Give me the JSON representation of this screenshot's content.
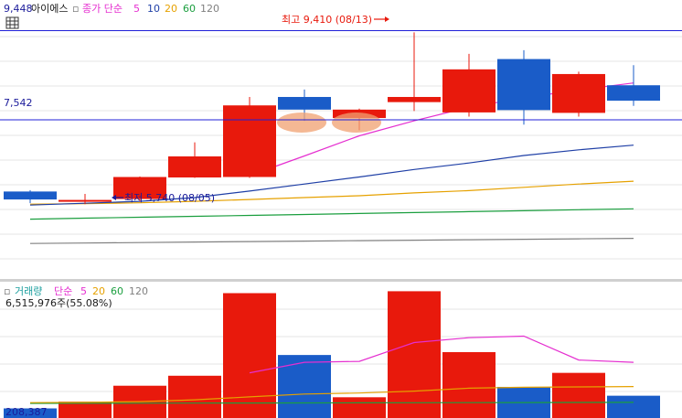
{
  "header": {
    "stock_name": "아이에스",
    "price_legend": {
      "label": "종가 단순",
      "periods": [
        "5",
        "10",
        "20",
        "60",
        "120"
      ]
    },
    "volume_legend": {
      "label": "거래량",
      "ma_label": "단순",
      "periods": [
        "5",
        "20",
        "60",
        "120"
      ]
    },
    "volume_info": "6,515,976주(55.08%)"
  },
  "price_axis": {
    "top_label": "9,448",
    "ref_label": "7,542",
    "top_value": 9448,
    "ref_value": 7542
  },
  "volume_axis": {
    "bottom_label": "208,387"
  },
  "annotations": {
    "high": "최고 9,410 (08/13)",
    "low": "최저 5,740 (08/05)"
  },
  "colors": {
    "up": "#e8190c",
    "down": "#1a5cc8",
    "ma5": "#e52fd0",
    "ma10": "#1f3fa6",
    "ma20": "#e6a100",
    "ma60": "#1a9e3e",
    "ma120": "#808080",
    "ref_line": "#2020d8",
    "highlight": "#f0a070"
  },
  "chart_data": {
    "type": "candlestick",
    "y_range": [
      4200,
      9750
    ],
    "candles": [
      {
        "open": 6010,
        "close": 5840,
        "high": 6040,
        "low": 5760
      },
      {
        "open": 5810,
        "close": 5830,
        "high": 5960,
        "low": 5740
      },
      {
        "open": 5850,
        "close": 6320,
        "high": 6330,
        "low": 5800
      },
      {
        "open": 6310,
        "close": 6760,
        "high": 7060,
        "low": 6300
      },
      {
        "open": 6320,
        "close": 7850,
        "high": 8030,
        "low": 6300
      },
      {
        "open": 8030,
        "close": 7760,
        "high": 8190,
        "low": 7520
      },
      {
        "open": 7580,
        "close": 7760,
        "high": 7780,
        "low": 7320
      },
      {
        "open": 7920,
        "close": 8030,
        "high": 9410,
        "low": 7730
      },
      {
        "open": 7700,
        "close": 8620,
        "high": 8950,
        "low": 7610
      },
      {
        "open": 8840,
        "close": 7750,
        "high": 9030,
        "low": 7440
      },
      {
        "open": 7690,
        "close": 8520,
        "high": 8570,
        "low": 7610
      },
      {
        "open": 8280,
        "close": 7950,
        "high": 8710,
        "low": 7840
      }
    ],
    "ma5": [
      null,
      null,
      null,
      null,
      6350,
      6770,
      7200,
      7520,
      7810,
      8010,
      8180,
      8330
    ],
    "ma10": [
      5720,
      5760,
      5800,
      5880,
      6020,
      6170,
      6320,
      6480,
      6620,
      6780,
      6900,
      7000
    ],
    "ma20": [
      5740,
      5750,
      5770,
      5800,
      5840,
      5880,
      5920,
      5980,
      6030,
      6100,
      6170,
      6230
    ],
    "ma60": [
      5420,
      5440,
      5460,
      5480,
      5500,
      5520,
      5540,
      5560,
      5580,
      5600,
      5620,
      5640
    ],
    "ma120": [
      4900,
      4910,
      4920,
      4930,
      4940,
      4950,
      4960,
      4970,
      4980,
      4990,
      5000,
      5010
    ],
    "volume": {
      "y_max": 7000000,
      "values": [
        500000,
        850000,
        1680000,
        2200000,
        6500000,
        3280000,
        1080000,
        6600000,
        3430000,
        1620000,
        2350000,
        1160000
      ],
      "ma5": [
        null,
        null,
        null,
        null,
        2350000,
        2900000,
        2950000,
        3930000,
        4180000,
        4260000,
        3020000,
        2900000
      ],
      "ma20": [
        800000,
        820000,
        850000,
        950000,
        1100000,
        1250000,
        1300000,
        1400000,
        1550000,
        1600000,
        1620000,
        1640000
      ],
      "ma60": [
        760000,
        765000,
        770000,
        775000,
        780000,
        785000,
        790000,
        795000,
        800000,
        805000,
        810000,
        815000
      ]
    }
  }
}
